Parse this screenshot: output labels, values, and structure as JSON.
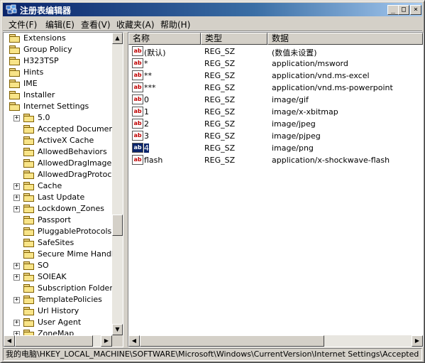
{
  "window": {
    "title": "注册表编辑器",
    "min_btn": "_",
    "max_btn": "□",
    "close_btn": "×"
  },
  "menu": [
    "文件(F)",
    "编辑(E)",
    "查看(V)",
    "收藏夹(A)",
    "帮助(H)"
  ],
  "tree": [
    {
      "label": "Extensions",
      "level": 0,
      "expander": ""
    },
    {
      "label": "Group Policy",
      "level": 0,
      "expander": ""
    },
    {
      "label": "H323TSP",
      "level": 0,
      "expander": ""
    },
    {
      "label": "Hints",
      "level": 0,
      "expander": ""
    },
    {
      "label": "IME",
      "level": 0,
      "expander": ""
    },
    {
      "label": "Installer",
      "level": 0,
      "expander": ""
    },
    {
      "label": "Internet Settings",
      "level": 0,
      "expander": ""
    },
    {
      "label": "5.0",
      "level": 1,
      "expander": "+"
    },
    {
      "label": "Accepted Documents",
      "level": 1,
      "expander": ""
    },
    {
      "label": "ActiveX Cache",
      "level": 1,
      "expander": ""
    },
    {
      "label": "AllowedBehaviors",
      "level": 1,
      "expander": ""
    },
    {
      "label": "AllowedDragImageExt",
      "level": 1,
      "expander": ""
    },
    {
      "label": "AllowedDragProtocols",
      "level": 1,
      "expander": ""
    },
    {
      "label": "Cache",
      "level": 1,
      "expander": "+"
    },
    {
      "label": "Last Update",
      "level": 1,
      "expander": "+"
    },
    {
      "label": "Lockdown_Zones",
      "level": 1,
      "expander": "+"
    },
    {
      "label": "Passport",
      "level": 1,
      "expander": ""
    },
    {
      "label": "PluggableProtocols",
      "level": 1,
      "expander": ""
    },
    {
      "label": "SafeSites",
      "level": 1,
      "expander": ""
    },
    {
      "label": "Secure Mime Handlers",
      "level": 1,
      "expander": ""
    },
    {
      "label": "SO",
      "level": 1,
      "expander": "+"
    },
    {
      "label": "SOIEAK",
      "level": 1,
      "expander": "+"
    },
    {
      "label": "Subscription Folder",
      "level": 1,
      "expander": ""
    },
    {
      "label": "TemplatePolicies",
      "level": 1,
      "expander": "+"
    },
    {
      "label": "Url History",
      "level": 1,
      "expander": ""
    },
    {
      "label": "User Agent",
      "level": 1,
      "expander": "+"
    },
    {
      "label": "ZoneMap",
      "level": 1,
      "expander": "+"
    }
  ],
  "columns": [
    "名称",
    "类型",
    "数据"
  ],
  "values": [
    {
      "name": "(默认)",
      "type": "REG_SZ",
      "data": "(数值未设置)"
    },
    {
      "name": "*",
      "type": "REG_SZ",
      "data": "application/msword"
    },
    {
      "name": "**",
      "type": "REG_SZ",
      "data": "application/vnd.ms-excel"
    },
    {
      "name": "***",
      "type": "REG_SZ",
      "data": "application/vnd.ms-powerpoint"
    },
    {
      "name": "0",
      "type": "REG_SZ",
      "data": "image/gif"
    },
    {
      "name": "1",
      "type": "REG_SZ",
      "data": "image/x-xbitmap"
    },
    {
      "name": "2",
      "type": "REG_SZ",
      "data": "image/jpeg"
    },
    {
      "name": "3",
      "type": "REG_SZ",
      "data": "image/pjpeg"
    },
    {
      "name": "4",
      "type": "REG_SZ",
      "data": "image/png",
      "selected": true
    },
    {
      "name": "flash",
      "type": "REG_SZ",
      "data": "application/x-shockwave-flash"
    }
  ],
  "value_icon": "ab",
  "status": "我的电脑\\HKEY_LOCAL_MACHINE\\SOFTWARE\\Microsoft\\Windows\\CurrentVersion\\Internet Settings\\Accepted Docume",
  "icons": {
    "app": "registry-editor-icon",
    "folder": "folder-icon",
    "value": "string-value-icon"
  }
}
